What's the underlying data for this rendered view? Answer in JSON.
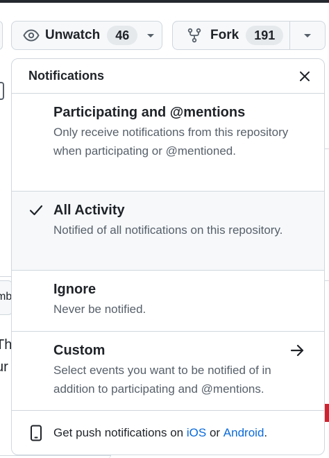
{
  "header": {
    "watch_label": "Unwatch",
    "watch_count": "46",
    "fork_label": "Fork",
    "fork_count": "191"
  },
  "background": {
    "left_text_1": "Th",
    "left_text_2": "ur",
    "left_chip_text": "mb"
  },
  "popover": {
    "title": "Notifications",
    "options": [
      {
        "title": "Participating and @mentions",
        "description": "Only receive notifications from this repository when participating or @mentioned.",
        "selected": false
      },
      {
        "title": "All Activity",
        "description": "Notified of all notifications on this repository.",
        "selected": true
      },
      {
        "title": "Ignore",
        "description": "Never be notified.",
        "selected": false
      },
      {
        "title": "Custom",
        "description": "Select events you want to be notified of in addition to participating and @mentions.",
        "selected": false
      }
    ],
    "footer": {
      "prefix": "Get push notifications on",
      "ios_link": "iOS",
      "joiner": "or",
      "android_link": "Android",
      "suffix": "."
    }
  },
  "colors": {
    "accent_link": "#0969da",
    "selected_bg": "#f6f8fa",
    "border": "#d0d7de",
    "muted_text": "#57606a"
  },
  "icons": {
    "watch": "eye-icon",
    "watch_caret": "triangle-down-icon",
    "fork": "repo-forked-icon",
    "fork_caret": "triangle-down-icon",
    "close": "x-icon",
    "selected": "check-icon",
    "custom": "arrow-right-icon",
    "footer": "device-mobile-icon"
  }
}
